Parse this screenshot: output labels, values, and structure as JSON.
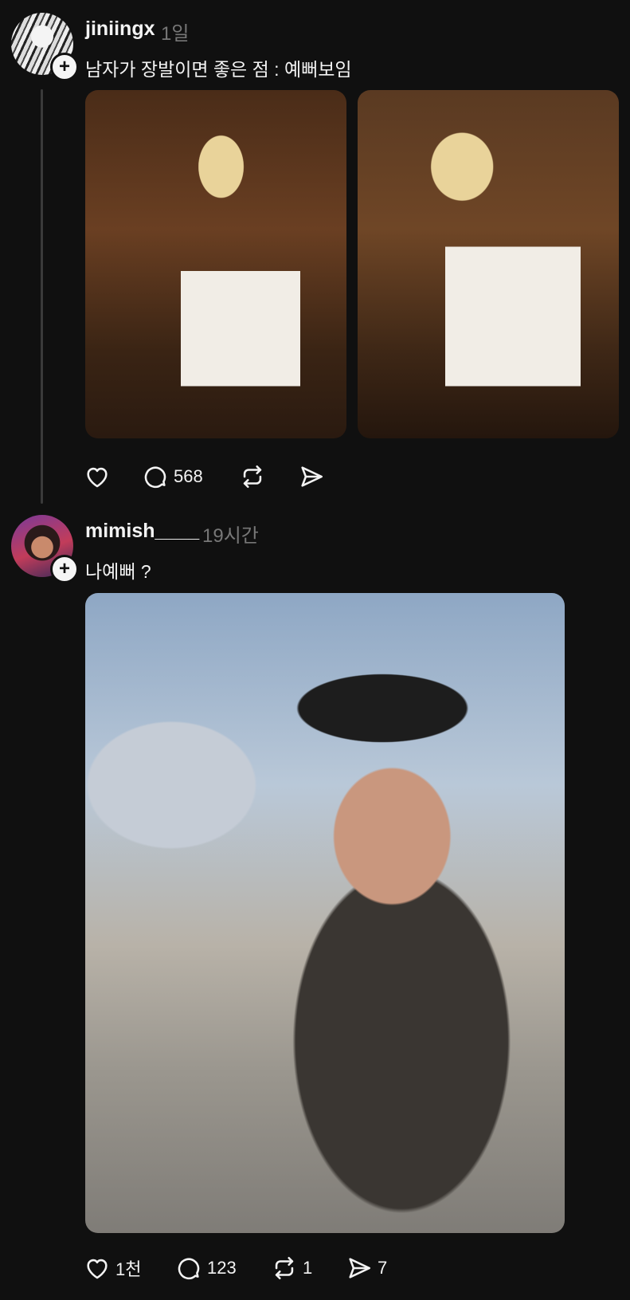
{
  "posts": [
    {
      "username": "jiniingx",
      "time": "1일",
      "text": "남자가 장발이면 좋은 점 : 예뻐보임",
      "images": [
        "post-photo",
        "post-photo"
      ],
      "actions": {
        "likes": "",
        "replies": "568",
        "reposts": "",
        "shares": ""
      }
    },
    {
      "username": "mimish____",
      "time": "19시간",
      "text": "나예뻐 ?",
      "images": [
        "post-photo"
      ],
      "actions": {
        "likes": "1천",
        "replies": "123",
        "reposts": "1",
        "shares": "7"
      }
    }
  ],
  "icons": {
    "like": "heart-icon",
    "reply": "comment-icon",
    "repost": "repost-icon",
    "share": "send-icon",
    "follow": "plus-icon"
  },
  "colors": {
    "background": "#101010",
    "text": "#f3f3f3",
    "muted": "#777777",
    "thread_line": "#3a3a3a"
  }
}
